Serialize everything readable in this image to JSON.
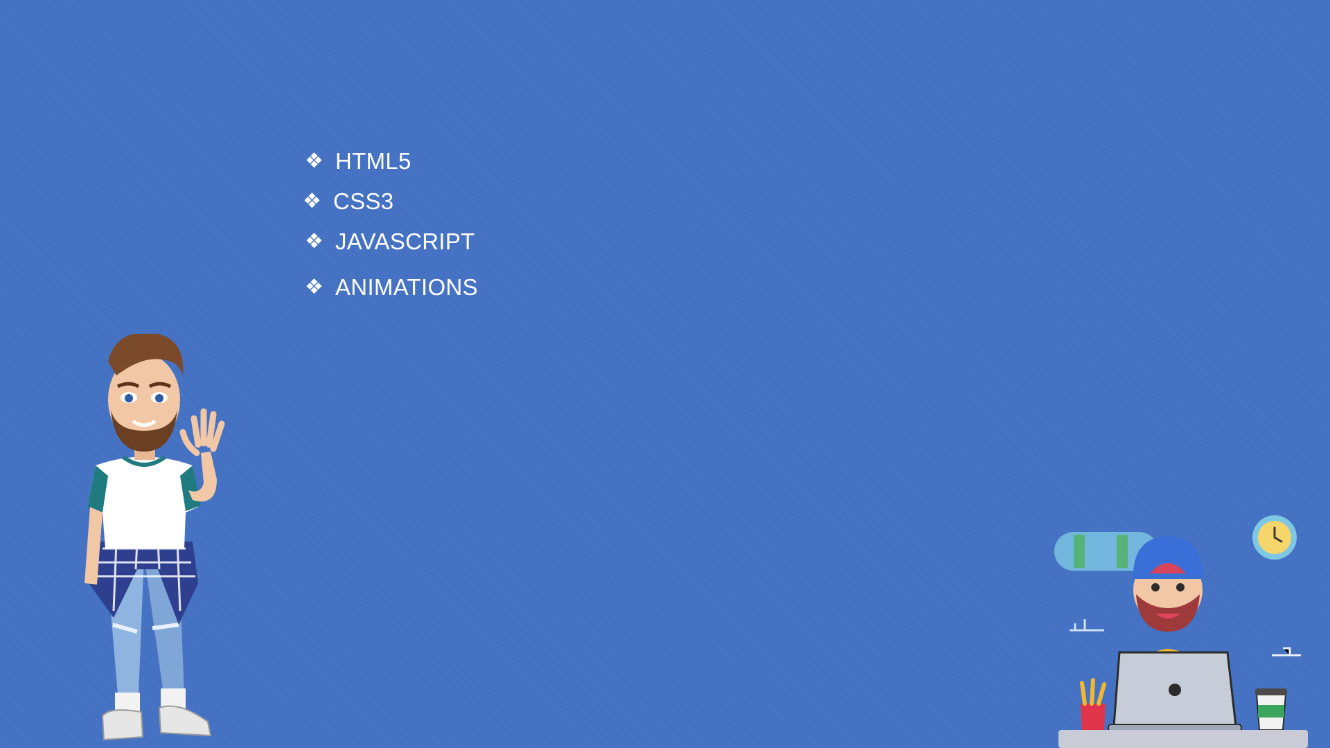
{
  "slide": {
    "background_color": "#4472C4",
    "bullet_glyph": "❖",
    "bullets": [
      {
        "label": "HTML5"
      },
      {
        "label": "CSS3"
      },
      {
        "label": "JAVASCRIPT"
      },
      {
        "label": "ANIMATIONS"
      }
    ]
  },
  "illustrations": {
    "left_character": "waving-man-avatar",
    "right_scene": "developer-at-laptop-illustration"
  }
}
